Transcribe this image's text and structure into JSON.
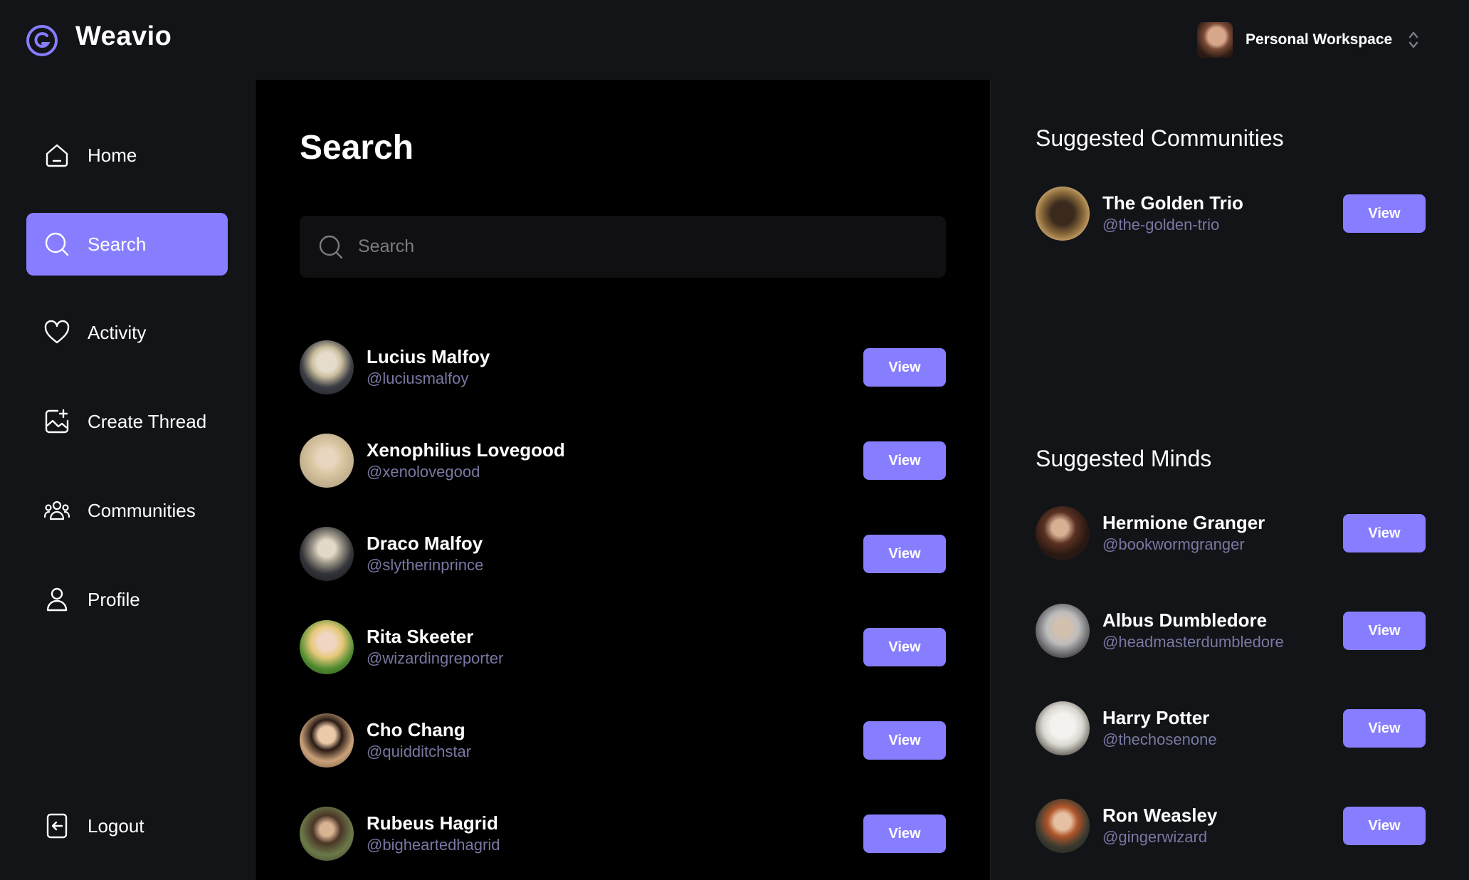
{
  "app": {
    "brand": "Weavio",
    "workspace_label": "Personal Workspace",
    "accent_color": "#877eff"
  },
  "sidebar": {
    "items": [
      {
        "label": "Home",
        "icon": "home-icon"
      },
      {
        "label": "Search",
        "icon": "search-icon",
        "active": true
      },
      {
        "label": "Activity",
        "icon": "heart-icon"
      },
      {
        "label": "Create Thread",
        "icon": "create-thread-icon"
      },
      {
        "label": "Communities",
        "icon": "communities-icon"
      },
      {
        "label": "Profile",
        "icon": "user-icon"
      }
    ],
    "logout_label": "Logout"
  },
  "main": {
    "title": "Search",
    "search_placeholder": "Search",
    "search_value": "",
    "users": [
      {
        "name": "Lucius Malfoy",
        "handle": "@luciusmalfoy",
        "button": "View"
      },
      {
        "name": "Xenophilius Lovegood",
        "handle": "@xenolovegood",
        "button": "View"
      },
      {
        "name": "Draco Malfoy",
        "handle": "@slytherinprince",
        "button": "View"
      },
      {
        "name": "Rita Skeeter",
        "handle": "@wizardingreporter",
        "button": "View"
      },
      {
        "name": "Cho Chang",
        "handle": "@quidditchstar",
        "button": "View"
      },
      {
        "name": "Rubeus Hagrid",
        "handle": "@bigheartedhagrid",
        "button": "View"
      }
    ]
  },
  "right": {
    "communities_title": "Suggested Communities",
    "communities": [
      {
        "name": "The Golden Trio",
        "handle": "@the-golden-trio",
        "button": "View"
      }
    ],
    "minds_title": "Suggested Minds",
    "minds": [
      {
        "name": "Hermione Granger",
        "handle": "@bookwormgranger",
        "button": "View"
      },
      {
        "name": "Albus Dumbledore",
        "handle": "@headmasterdumbledore",
        "button": "View"
      },
      {
        "name": "Harry Potter",
        "handle": "@thechosenone",
        "button": "View"
      },
      {
        "name": "Ron Weasley",
        "handle": "@gingerwizard",
        "button": "View"
      }
    ]
  }
}
